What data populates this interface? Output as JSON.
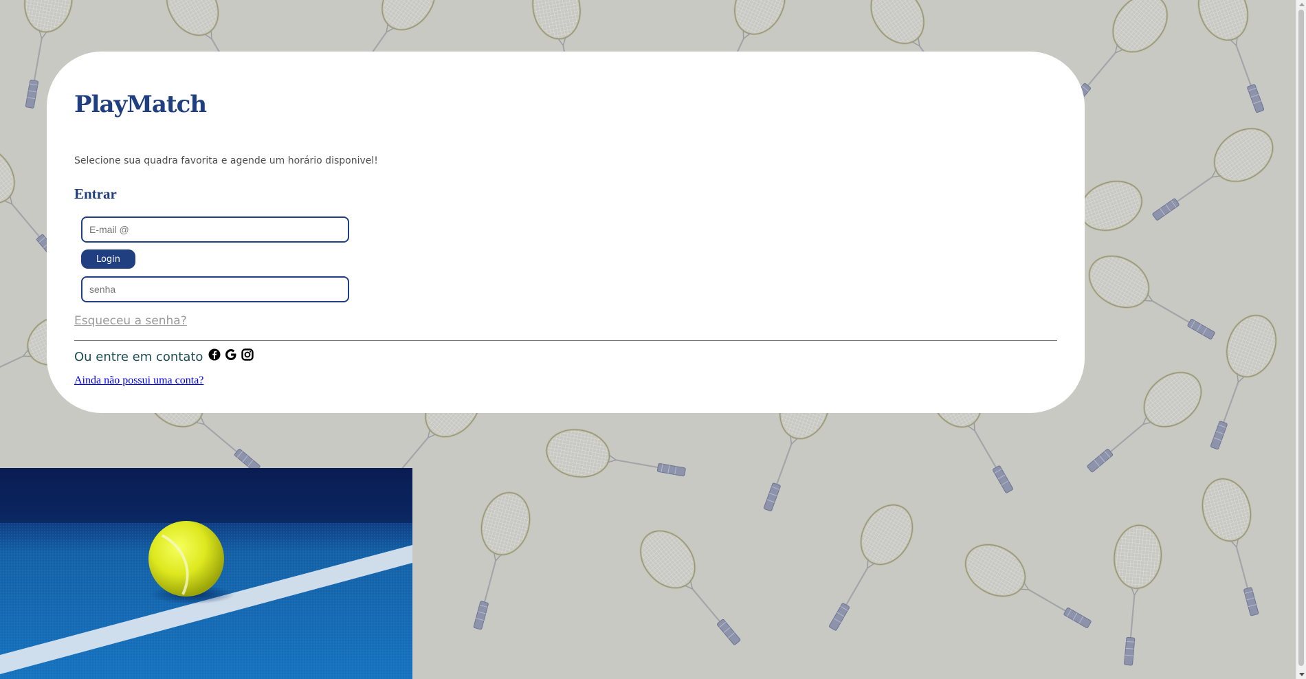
{
  "login_card": {
    "brand": "PlayMatch",
    "tagline": "Selecione sua quadra favorita e agende um horário disponivel!",
    "section_title": "Entrar",
    "email": {
      "placeholder": "E-mail @",
      "value": ""
    },
    "login_button": "Login",
    "password": {
      "placeholder": "senha",
      "value": ""
    },
    "forgot_password": "Esqueceu a senha?",
    "contact_label": "Ou entre em contato",
    "social_icons": [
      "facebook-icon",
      "google-icon",
      "instagram-icon"
    ],
    "signup_link": "Ainda não possui uma conta?"
  },
  "colors": {
    "primary": "#1f3f80",
    "background": "#c9c9c4",
    "card": "#ffffff",
    "link": "#0000ee",
    "muted_link": "#9b9b9b",
    "contact_text": "#1d4d55"
  }
}
